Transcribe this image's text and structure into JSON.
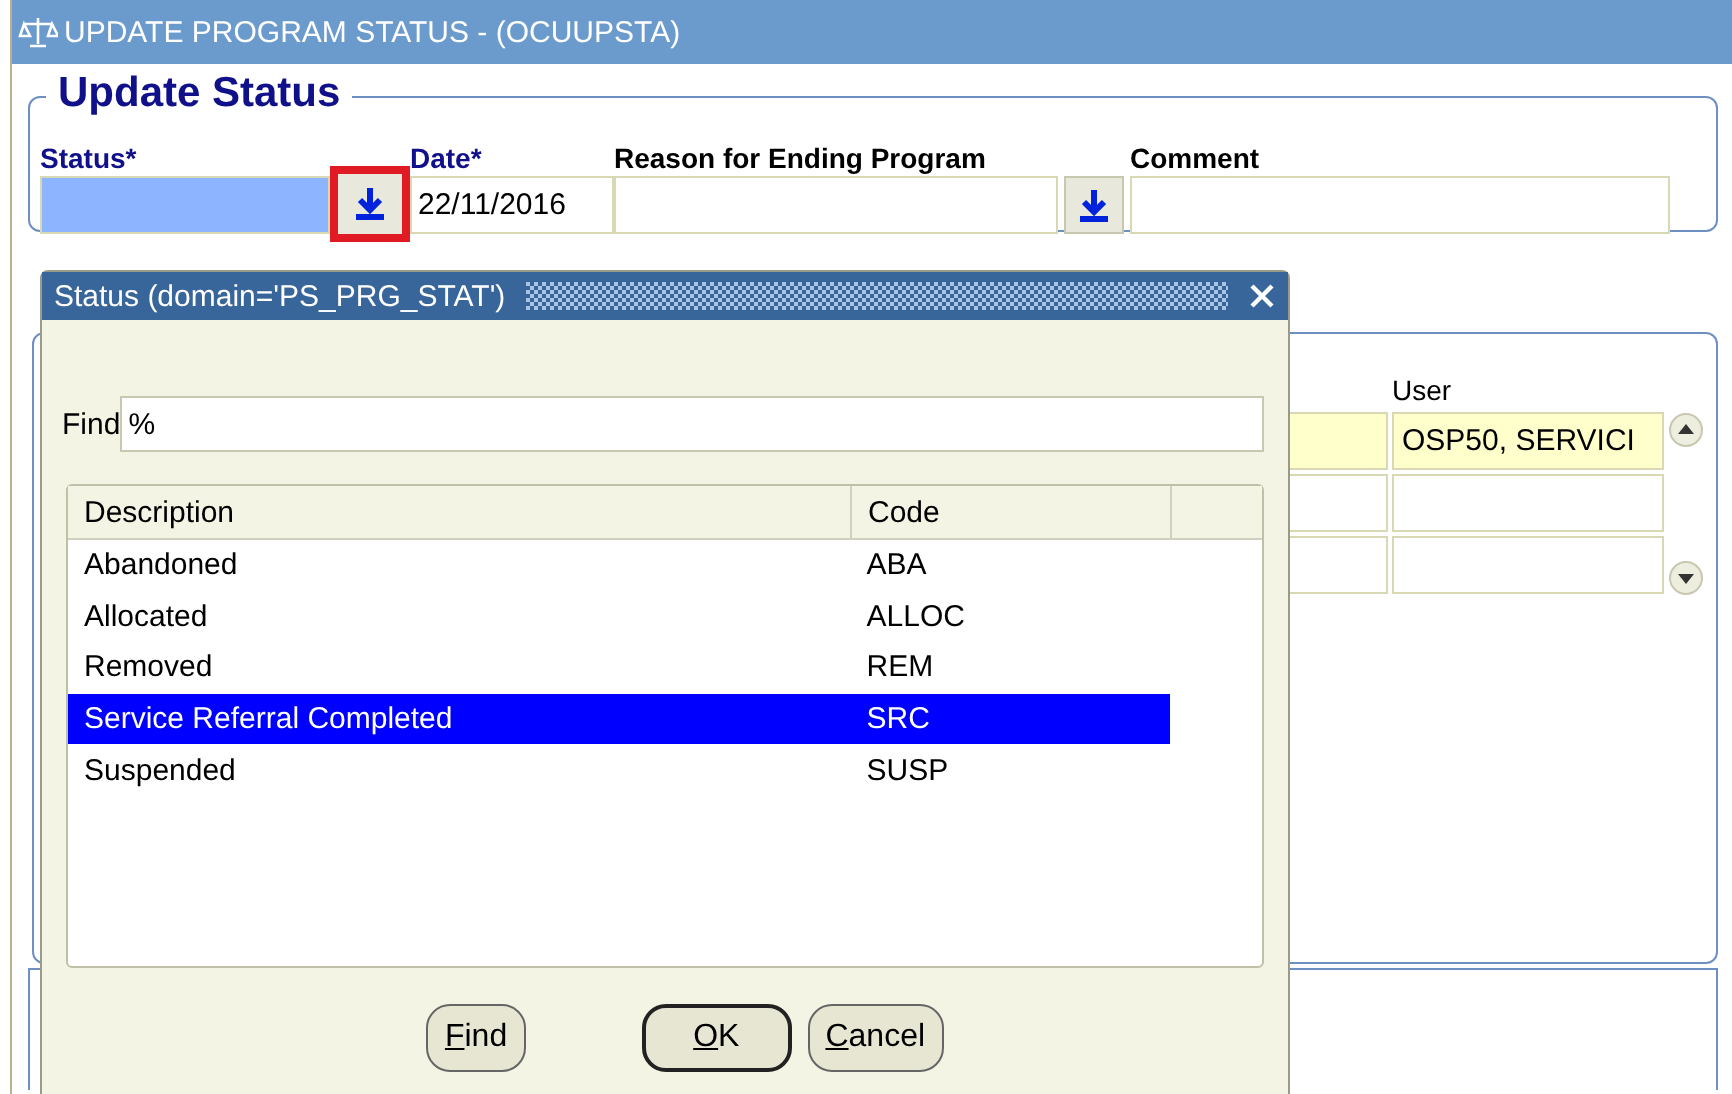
{
  "window": {
    "title": "UPDATE PROGRAM STATUS - (OCUUPSTA)"
  },
  "update_status": {
    "legend": "Update Status",
    "fields": [
      {
        "label": "Status*",
        "kind": "lov",
        "focused": true,
        "highlighted": true,
        "required": true
      },
      {
        "label": "Date*",
        "kind": "text",
        "value": "22/11/2016",
        "focused": false,
        "required": true
      },
      {
        "label": "Reason for Ending Program",
        "kind": "lov",
        "focused": false,
        "highlighted": false,
        "required": false
      },
      {
        "label": "Comment",
        "kind": "text",
        "focused": false,
        "required": false
      }
    ]
  },
  "records": {
    "header": "User",
    "rows": [
      {
        "user": "OSP50, SERVICI",
        "current": true
      },
      {
        "current": false
      },
      {
        "current": false
      }
    ]
  },
  "dialog": {
    "title": "Status (domain='PS_PRG_STAT')",
    "find_label": "Find",
    "find_value": "%",
    "columns": [
      "Description",
      "Code"
    ],
    "rows": [
      {
        "description": "Abandoned",
        "code": "ABA",
        "selected": false
      },
      {
        "description": "Allocated",
        "code": "ALLOC",
        "selected": false
      },
      {
        "description": "Removed",
        "code": "REM",
        "selected": false
      },
      {
        "description": "Service Referral Completed",
        "code": "SRC",
        "selected": true
      },
      {
        "description": "Suspended",
        "code": "SUSP",
        "selected": false
      }
    ],
    "buttons": [
      {
        "label": "Find",
        "default": false
      },
      {
        "label": "OK",
        "default": true
      },
      {
        "label": "Cancel",
        "default": false
      }
    ]
  }
}
